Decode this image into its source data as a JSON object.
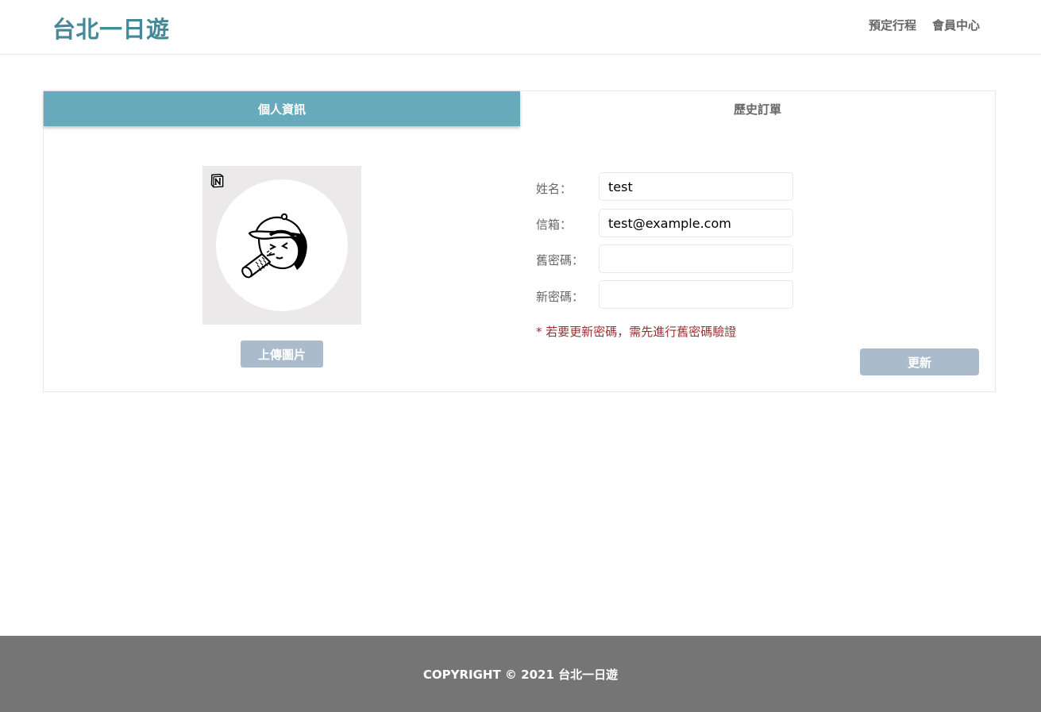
{
  "header": {
    "logo": "台北一日遊",
    "nav": [
      "預定行程",
      "會員中心"
    ]
  },
  "tabs": {
    "active": "個人資訊",
    "inactive": "歷史訂單"
  },
  "avatar": {
    "upload_label": "上傳圖片",
    "badge_icon": "notion-icon",
    "image_icon": "cartoon-face-icon"
  },
  "form": {
    "name_label": "姓名：",
    "name_value": "test",
    "email_label": "信箱：",
    "email_value": "test@example.com",
    "old_password_label": "舊密碼：",
    "old_password_value": "",
    "new_password_label": "新密碼：",
    "new_password_value": "",
    "hint": "* 若要更新密碼，需先進行舊密碼驗證",
    "submit_label": "更新"
  },
  "footer": {
    "copyright": "COPYRIGHT © 2021 台北一日遊"
  },
  "colors": {
    "brand": "#448899",
    "tab_active": "#66aabb",
    "button": "#aabbcc",
    "warning": "#993333",
    "footer": "#757575"
  }
}
